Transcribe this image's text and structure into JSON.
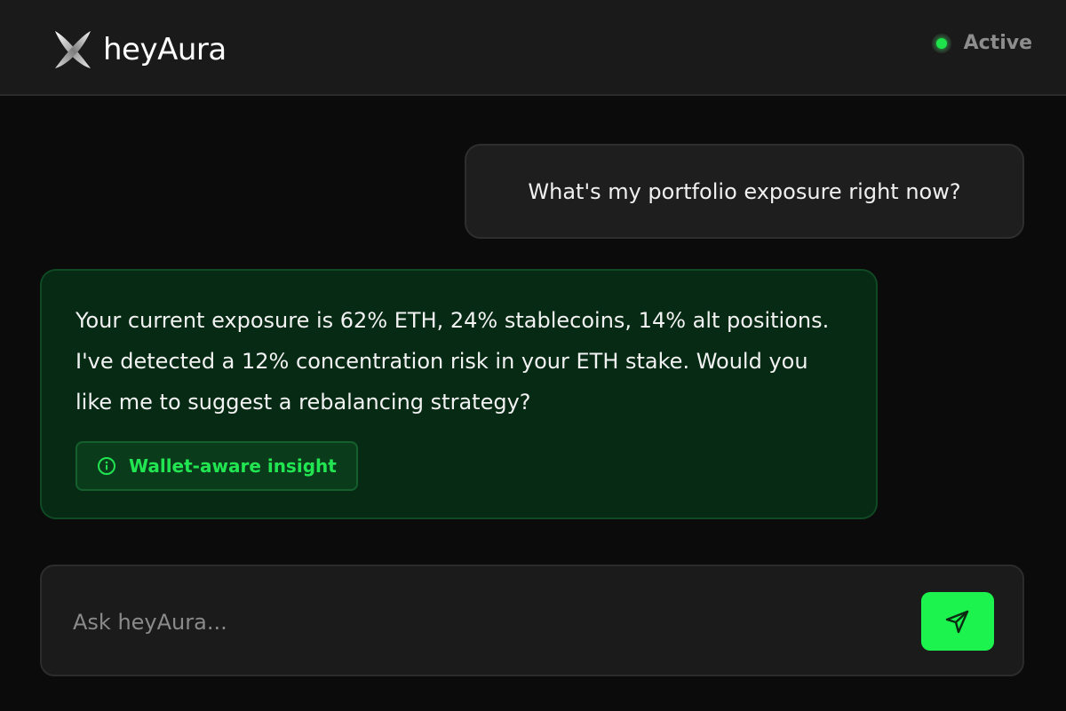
{
  "header": {
    "logo_icon": "aura-logo-icon",
    "app_name": "heyAura",
    "status_label": "Active",
    "status_color": "#1ee34a"
  },
  "conversation": {
    "user_message": "What's my portfolio exposure right now?",
    "assistant_message": "Your current exposure is 62% ETH, 24% stablecoins, 14% alt positions. I've detected a 12% concentration risk in your ETH stake. Would you like me to suggest a rebalancing strategy?",
    "insight_badge": {
      "icon": "info-icon",
      "label": "Wallet-aware insight",
      "color": "#22e552"
    }
  },
  "composer": {
    "placeholder": "Ask heyAura...",
    "value": "",
    "send_icon": "send-icon",
    "send_color": "#1cf34e"
  }
}
